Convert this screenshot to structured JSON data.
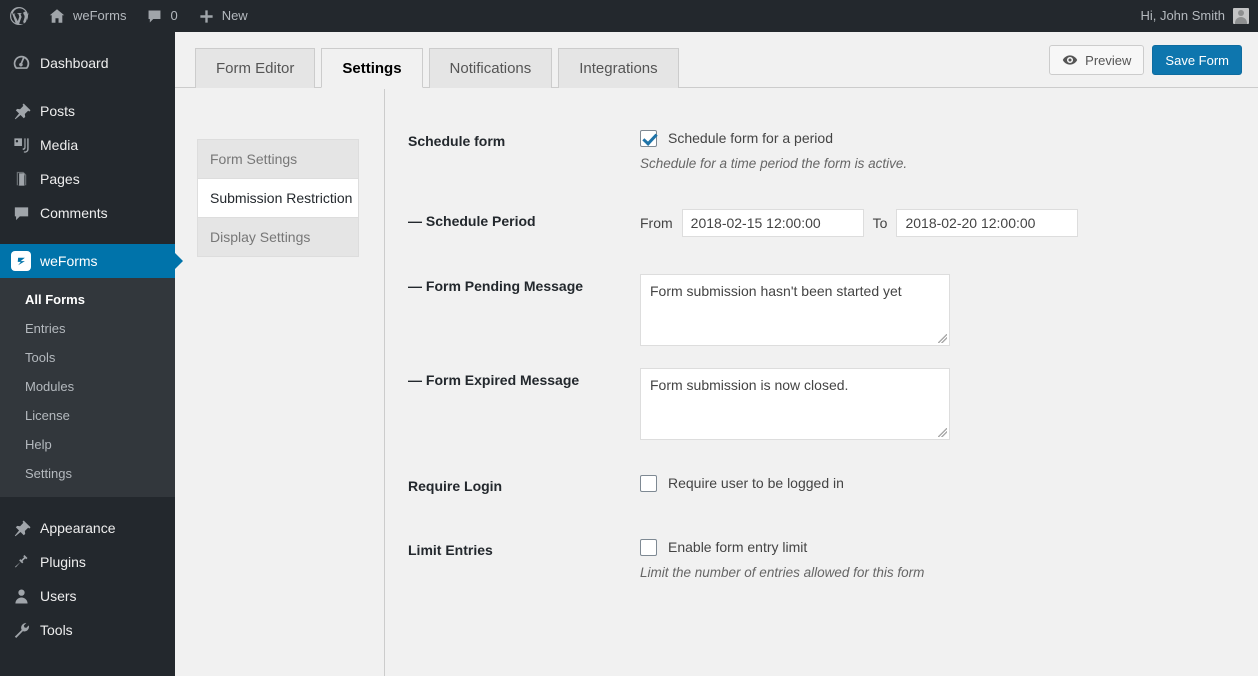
{
  "adminbar": {
    "logo_icon": "wordpress-logo-icon",
    "site_icon": "home-icon",
    "site_name": "weForms",
    "comments_icon": "comment-bubble-icon",
    "comments_count": "0",
    "new_icon": "plus-icon",
    "new_label": "New",
    "greeting": "Hi, John Smith",
    "avatar_icon": "user-avatar"
  },
  "adminmenu": {
    "items": [
      {
        "label": "Dashboard",
        "icon": "dashboard-icon",
        "current": false
      },
      {
        "label": "Posts",
        "icon": "pin-icon",
        "current": false
      },
      {
        "label": "Media",
        "icon": "media-icon",
        "current": false
      },
      {
        "label": "Pages",
        "icon": "pages-icon",
        "current": false
      },
      {
        "label": "Comments",
        "icon": "comment-bubble-icon",
        "current": false
      },
      {
        "label": "weForms",
        "icon": "weforms-logo-icon",
        "current": true
      }
    ],
    "submenu": [
      {
        "label": "All Forms",
        "current": true
      },
      {
        "label": "Entries",
        "current": false
      },
      {
        "label": "Tools",
        "current": false
      },
      {
        "label": "Modules",
        "current": false
      },
      {
        "label": "License",
        "current": false
      },
      {
        "label": "Help",
        "current": false
      },
      {
        "label": "Settings",
        "current": false
      }
    ],
    "items_bottom": [
      {
        "label": "Appearance",
        "icon": "appearance-brush-icon",
        "current": false
      },
      {
        "label": "Plugins",
        "icon": "plug-icon",
        "current": false
      },
      {
        "label": "Users",
        "icon": "user-icon",
        "current": false
      },
      {
        "label": "Tools",
        "icon": "wrench-icon",
        "current": false
      }
    ]
  },
  "tabs": [
    {
      "label": "Form Editor",
      "active": false
    },
    {
      "label": "Settings",
      "active": true
    },
    {
      "label": "Notifications",
      "active": false
    },
    {
      "label": "Integrations",
      "active": false
    }
  ],
  "actions": {
    "preview_label": "Preview",
    "preview_icon": "eye-icon",
    "save_label": "Save Form",
    "primary_color": "#0e76ae"
  },
  "settings_nav": [
    {
      "label": "Form Settings",
      "active": false
    },
    {
      "label": "Submission Restriction",
      "active": true
    },
    {
      "label": "Display Settings",
      "active": false
    }
  ],
  "form": {
    "schedule_form": {
      "label": "Schedule form",
      "checkbox_label": "Schedule form for a period",
      "checked": true,
      "help": "Schedule for a time period the form is active."
    },
    "schedule_period": {
      "label": "— Schedule Period",
      "from_label": "From",
      "from_value": "2018-02-15 12:00:00",
      "to_label": "To",
      "to_value": "2018-02-20 12:00:00"
    },
    "pending_message": {
      "label": "— Form Pending Message",
      "value": "Form submission hasn't been started yet"
    },
    "expired_message": {
      "label": "— Form Expired Message",
      "value": "Form submission is now closed."
    },
    "require_login": {
      "label": "Require Login",
      "checkbox_label": "Require user to be logged in",
      "checked": false
    },
    "limit_entries": {
      "label": "Limit Entries",
      "checkbox_label": "Enable form entry limit",
      "checked": false,
      "help": "Limit the number of entries allowed for this form"
    }
  }
}
